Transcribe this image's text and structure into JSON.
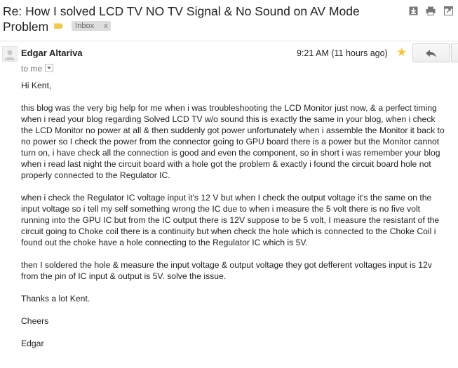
{
  "subject": {
    "title": "Re: How I solved LCD TV NO TV Signal & No Sound on AV Mode Problem",
    "label_chip": "Inbox",
    "chip_close": "x"
  },
  "toolbar_icons": [
    "download-icon",
    "print-icon",
    "new-window-icon"
  ],
  "message": {
    "sender": "Edgar Altariva",
    "timestamp": "9:21 AM (11 hours ago)",
    "to": "to me",
    "starred": true,
    "star_color": "#f7c531",
    "body": [
      "Hi Kent,",
      "this blog was the very big help for me when i was troubleshooting the LCD Monitor just now, & a perfect timing when i read your blog regarding Solved LCD TV w/o sound this is exactly the same in your blog, when i check the LCD Monitor no power at all & then suddenly got power unfortunately when i assemble the Monitor it back to no power so I check the power from the connector going to GPU board there is a power but the Monitor cannot turn on, i have check all the connection is good and even the component, so in short i was remember your blog when i read last night the circuit board with a hole got the problem & exactly i found the circuit board hole not properly connected to the Regulator IC.",
      "when i check the Regulator IC voltage input it's 12 V but when I check the output voltage it's the same on the input voltage so i tell my self something wrong the IC due to when i measure the 5 volt there is no five volt running into the GPU IC but from the IC output there is 12V suppose to be 5 volt, I measure the resistant of the circuit going to Choke coil there is a continuity but when check the hole which is connected to the Choke Coil i found out the choke have a hole connecting to the Regulator IC which is 5V.",
      "then I soldered the hole & measure the input voltage & output voltage they got defferent voltages input is 12v from the pin of IC input & output is 5V. solve the issue.",
      "Thanks a lot Kent.",
      "Cheers",
      "Edgar"
    ]
  }
}
